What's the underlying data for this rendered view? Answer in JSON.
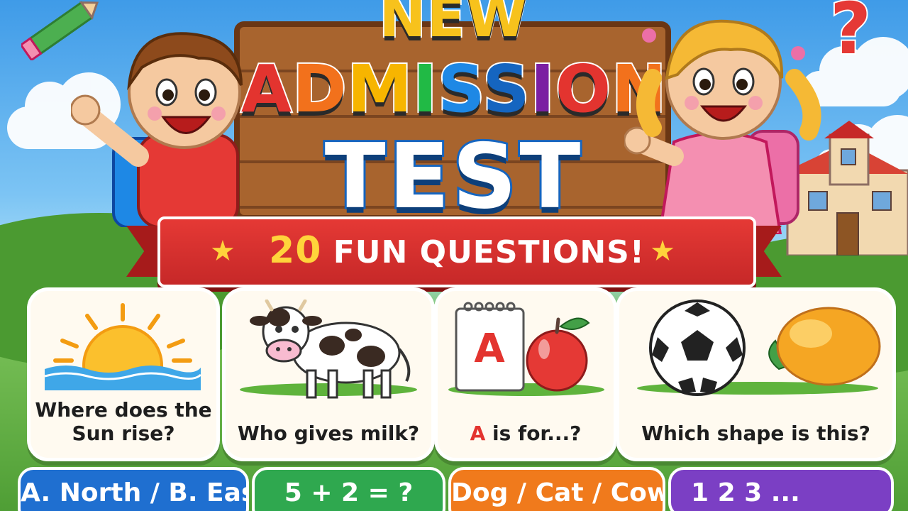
{
  "header": {
    "title_line1": "NEW",
    "title_line2_letters": [
      "A",
      "D",
      "M",
      "I",
      "S",
      "S",
      "I",
      "O",
      "N"
    ],
    "title_line3": "TEST"
  },
  "banner": {
    "count": "20",
    "label": "FUN QUESTIONS!"
  },
  "cards": [
    {
      "question": "Where does the Sun rise?",
      "icon": "sun-icon"
    },
    {
      "question": "Who gives milk?",
      "icon": "cow-icon"
    },
    {
      "question_prefix": "A",
      "question_rest": " is for...?",
      "icon": "apple-icon"
    },
    {
      "question": "Which shape is this?",
      "icon": "ball-icon"
    }
  ],
  "answers": [
    {
      "label": "A. North / B. East",
      "color": "#1f6fd0"
    },
    {
      "label": "5 + 2 = ?",
      "color": "#2fa84f"
    },
    {
      "label": "Dog / Cat / Cow",
      "color": "#f07a1c"
    },
    {
      "label": "1 2 3 ...",
      "color": "#7b3fc4"
    }
  ],
  "colors": {
    "ribbon": "#e53935",
    "star": "#ffd43b",
    "board": "#a8642e"
  }
}
